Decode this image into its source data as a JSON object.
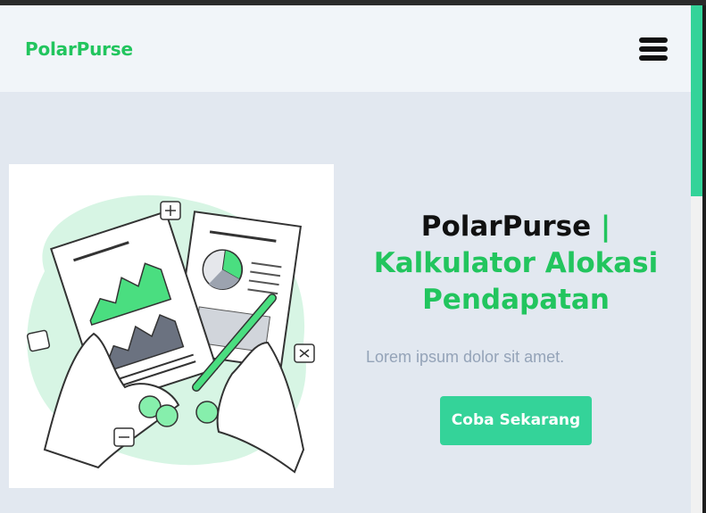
{
  "navbar": {
    "brand": "PolarPurse",
    "menu_icon": "hamburger-menu-icon"
  },
  "hero": {
    "title_main": "PolarPurse",
    "title_sep": " |",
    "title_accent": "Kalkulator Alokasi Pendapatan",
    "subtitle": "Lorem ipsum dolor sit amet.",
    "cta_label": "Coba Sekarang",
    "illustration": "finance-report-illustration"
  },
  "colors": {
    "accent": "#22c55e",
    "button": "#34d399",
    "page_bg": "#e2e8f0",
    "navbar_bg": "#f1f5f9",
    "subtitle": "#94a3b8"
  },
  "scrollbar": {
    "position_fraction": 0.0
  }
}
